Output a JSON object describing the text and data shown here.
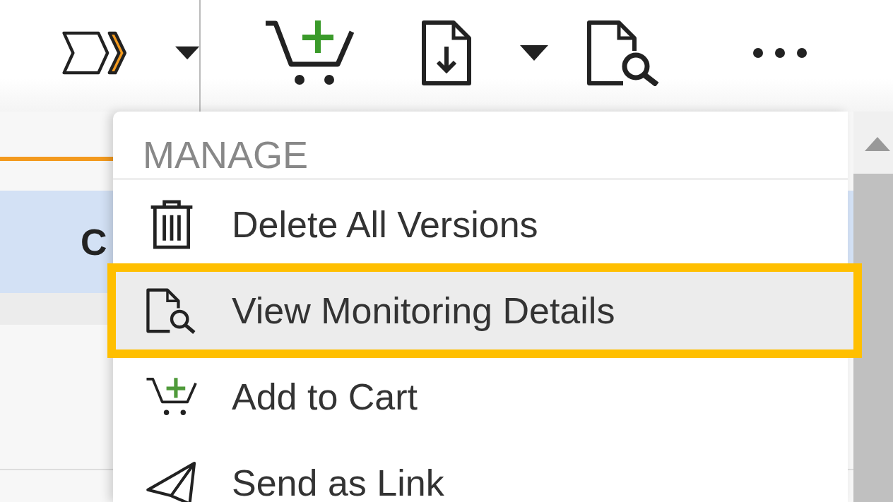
{
  "background_row": {
    "text": "C"
  },
  "menu": {
    "header": "MANAGE",
    "items": [
      {
        "kind": "trash",
        "label": "Delete All Versions",
        "selected": false
      },
      {
        "kind": "doc-search",
        "label": "View Monitoring Details",
        "selected": true
      },
      {
        "kind": "cart",
        "label": "Add to Cart",
        "selected": false
      },
      {
        "kind": "send",
        "label": "Send as Link",
        "selected": false
      }
    ]
  }
}
